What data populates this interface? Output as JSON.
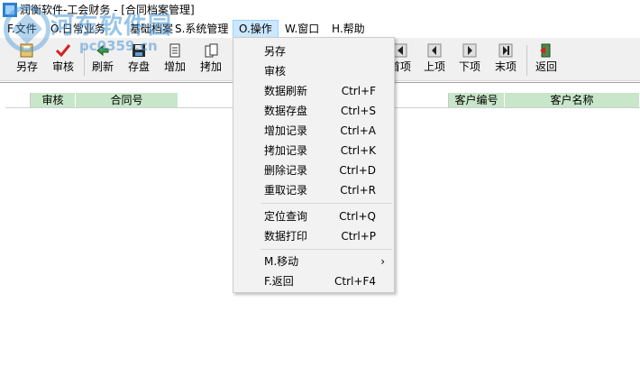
{
  "window": {
    "title": "润衡软件-工会财务 - [合同档案管理]"
  },
  "watermark": {
    "text": "河东软件园",
    "url": "pc0359.cn"
  },
  "menubar": {
    "items": [
      {
        "label": "F.文件"
      },
      {
        "label": "O.日常业务"
      },
      {
        "label": "基础档案"
      },
      {
        "label": "S.系统管理"
      },
      {
        "label": "O.操作"
      },
      {
        "label": "W.窗口"
      },
      {
        "label": "H.帮助"
      }
    ]
  },
  "toolbar": {
    "left": [
      {
        "label": "另存",
        "icon": "save-as-icon"
      },
      {
        "label": "审核",
        "icon": "check-icon"
      },
      {
        "label": "刷新",
        "icon": "refresh-icon"
      },
      {
        "label": "存盘",
        "icon": "disk-icon"
      },
      {
        "label": "增加",
        "icon": "add-record-icon"
      },
      {
        "label": "拷加",
        "icon": "copy-add-icon"
      }
    ],
    "right": [
      {
        "label": "首项",
        "icon": "first-icon"
      },
      {
        "label": "上项",
        "icon": "prev-icon"
      },
      {
        "label": "下项",
        "icon": "next-icon"
      },
      {
        "label": "末项",
        "icon": "last-icon"
      },
      {
        "label": "返回",
        "icon": "return-icon"
      }
    ]
  },
  "table": {
    "columns": [
      "审核",
      "合同号",
      "",
      "客户编号",
      "客户名称"
    ]
  },
  "dropdown": {
    "groups": [
      [
        {
          "label": "另存",
          "shortcut": ""
        },
        {
          "label": "审核",
          "shortcut": ""
        },
        {
          "label": "数据刷新",
          "shortcut": "Ctrl+F"
        },
        {
          "label": "数据存盘",
          "shortcut": "Ctrl+S"
        },
        {
          "label": "增加记录",
          "shortcut": "Ctrl+A"
        },
        {
          "label": "拷加记录",
          "shortcut": "Ctrl+K"
        },
        {
          "label": "删除记录",
          "shortcut": "Ctrl+D"
        },
        {
          "label": "重取记录",
          "shortcut": "Ctrl+R"
        }
      ],
      [
        {
          "label": "定位查询",
          "shortcut": "Ctrl+Q"
        },
        {
          "label": "数据打印",
          "shortcut": "Ctrl+P"
        }
      ],
      [
        {
          "label": "M.移动",
          "shortcut": "",
          "submenu": true
        },
        {
          "label": "F.返回",
          "shortcut": "Ctrl+F4"
        }
      ]
    ]
  },
  "colors": {
    "header_green": "#c8e6c9",
    "menu_active": "#cce8ff",
    "toolbar_bg": "#f0f0f0",
    "dropdown_bg": "#f2f2f2"
  }
}
